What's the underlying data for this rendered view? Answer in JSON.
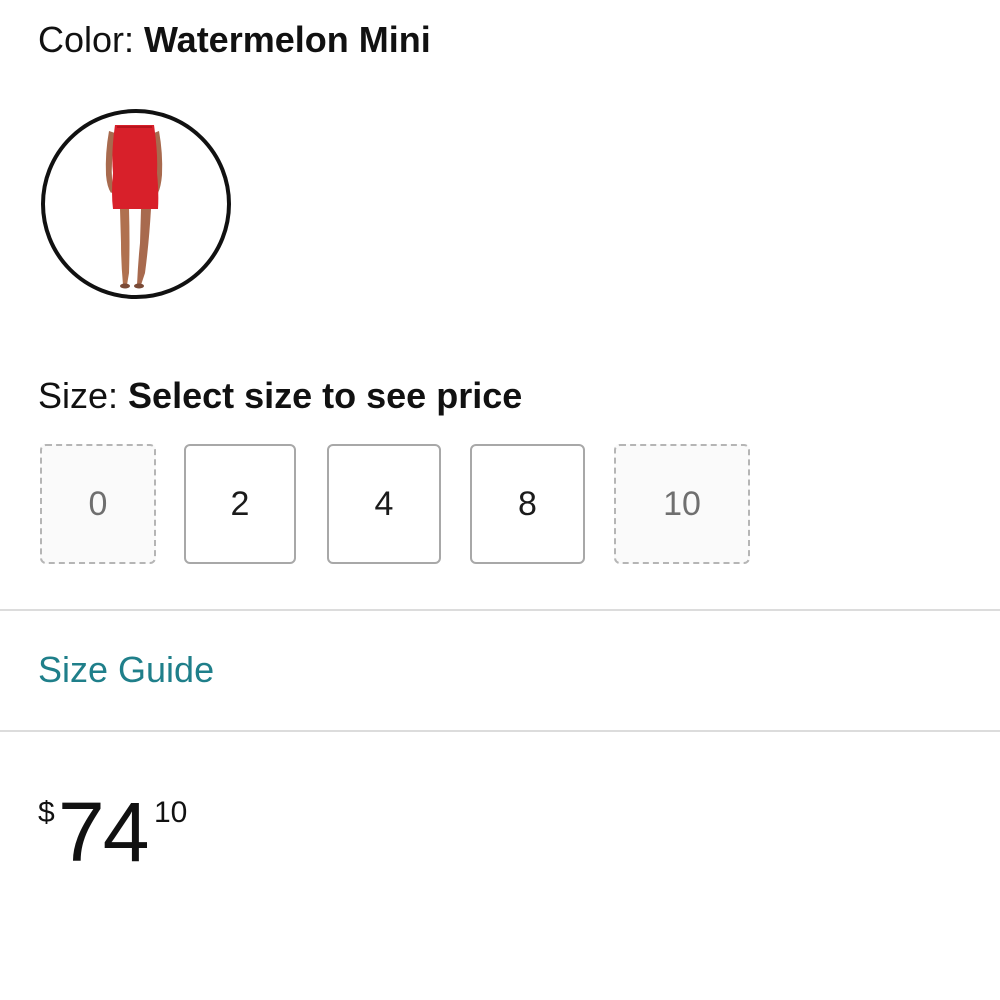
{
  "color": {
    "label": "Color: ",
    "value": "Watermelon Mini",
    "swatch_icon": "dress-swatch-icon",
    "swatch_color": "#d8202a"
  },
  "size": {
    "label": "Size: ",
    "value": "Select size to see price",
    "options": [
      {
        "label": "0",
        "available": false
      },
      {
        "label": "2",
        "available": true
      },
      {
        "label": "4",
        "available": true
      },
      {
        "label": "8",
        "available": true
      },
      {
        "label": "10",
        "available": false
      }
    ]
  },
  "size_guide": {
    "label": "Size Guide",
    "color": "#1f7f8a"
  },
  "price": {
    "symbol": "$",
    "whole": "74",
    "fraction": "10"
  }
}
